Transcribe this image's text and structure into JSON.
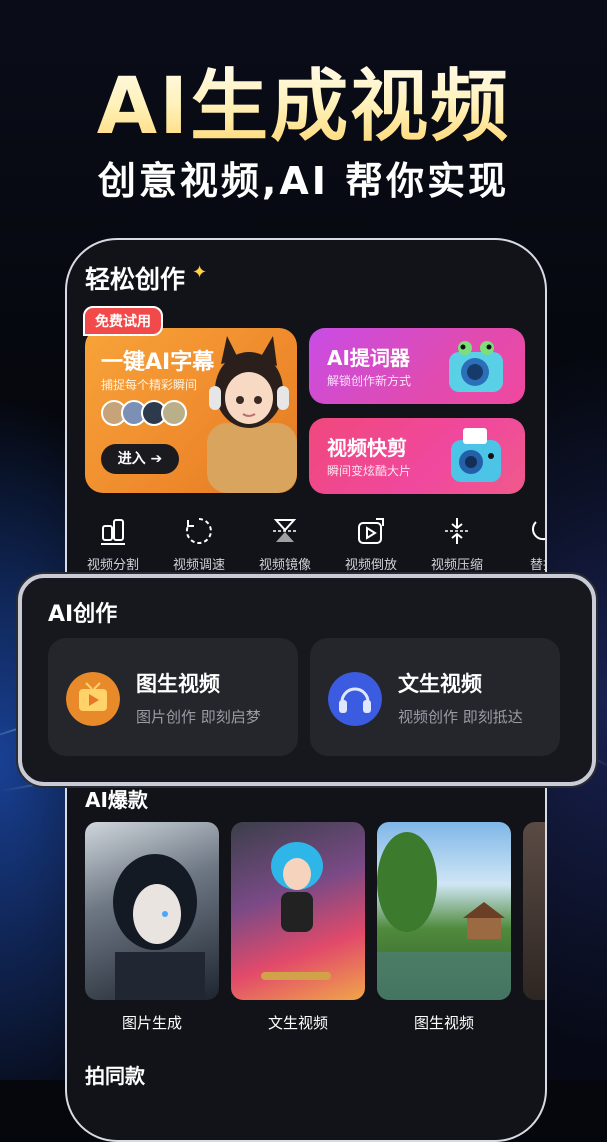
{
  "hero": {
    "title": "AI生成视频",
    "subtitle": "创意视频,AI 帮你实现"
  },
  "easy_create": {
    "title": "轻松创作",
    "big_card": {
      "badge": "免费试用",
      "title": "一键AI字幕",
      "subtitle": "捕捉每个精彩瞬间",
      "button": "进入 ➔"
    },
    "small_cards": [
      {
        "title": "AI提词器",
        "subtitle": "解锁创作新方式"
      },
      {
        "title": "视频快剪",
        "subtitle": "瞬间变炫酷大片"
      }
    ]
  },
  "tools": [
    {
      "label": "视频分割",
      "icon": "split-icon"
    },
    {
      "label": "视频调速",
      "icon": "speed-icon"
    },
    {
      "label": "视频镜像",
      "icon": "mirror-icon"
    },
    {
      "label": "视频倒放",
      "icon": "reverse-icon"
    },
    {
      "label": "视频压缩",
      "icon": "compress-icon"
    },
    {
      "label": "替换",
      "icon": "replace-icon"
    }
  ],
  "ai_create": {
    "title": "AI创作",
    "cards": [
      {
        "title": "图生视频",
        "subtitle": "图片创作 即刻启梦",
        "icon": "tv-icon"
      },
      {
        "title": "文生视频",
        "subtitle": "视频创作 即刻抵达",
        "icon": "headphones-icon"
      }
    ]
  },
  "hot": {
    "title": "AI爆款",
    "items": [
      {
        "label": "图片生成"
      },
      {
        "label": "文生视频"
      },
      {
        "label": "图生视频"
      }
    ]
  },
  "same_style": {
    "title": "拍同款"
  },
  "colors": {
    "accent_orange": "#f29b36",
    "accent_pink": "#f0488e",
    "accent_purple": "#c64ee0",
    "panel_border": "#c9ccd6"
  }
}
